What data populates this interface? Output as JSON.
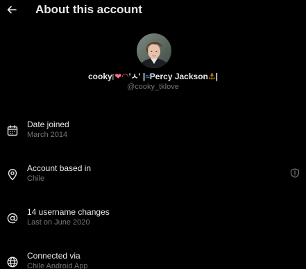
{
  "header": {
    "title": "About this account",
    "back_icon": "arrow-left-icon"
  },
  "profile": {
    "display_name_prefix": "cooky",
    "display_name_mid": "'ㅅ' |",
    "display_name_main": "Percy Jackson",
    "display_name_suffix": "|",
    "handle": "@cooky_tklove"
  },
  "rows": [
    {
      "icon": "calendar-icon",
      "label": "Date joined",
      "value": "March 2014"
    },
    {
      "icon": "location-pin-icon",
      "label": "Account based in",
      "value": "Chile",
      "right_icon": "shield-info-icon"
    },
    {
      "icon": "at-sign-icon",
      "label": "14 username changes",
      "value": "Last on June 2020"
    },
    {
      "icon": "globe-icon",
      "label": "Connected via",
      "value": "Chile Android App"
    }
  ],
  "colors": {
    "background": "#000000",
    "primary_text": "#e7e9ea",
    "secondary_text": "#71767b"
  }
}
